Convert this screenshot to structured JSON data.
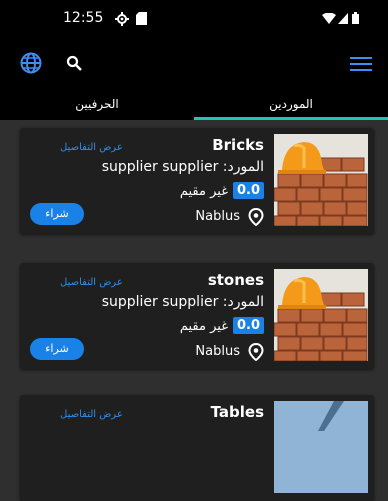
{
  "status_bar": {
    "time": "12:55"
  },
  "tabs": [
    {
      "label": "الحرفيين"
    },
    {
      "label": "الموردين"
    }
  ],
  "accent_color": "#21c7b1",
  "button_color": "#1a82e6",
  "products": [
    {
      "title": "Bricks",
      "supplier_label": "المورد: supplier supplier",
      "rating": "0.0",
      "status": "غير مقيم",
      "location": "Nablus",
      "details_label": "عرض التفاصيل",
      "buy_label": "شراء"
    },
    {
      "title": "stones",
      "supplier_label": "المورد: supplier supplier",
      "rating": "0.0",
      "status": "غير مقيم",
      "location": "Nablus",
      "details_label": "عرض التفاصيل",
      "buy_label": "شراء"
    },
    {
      "title": "Tables",
      "details_label": "عرض التفاصيل"
    }
  ]
}
